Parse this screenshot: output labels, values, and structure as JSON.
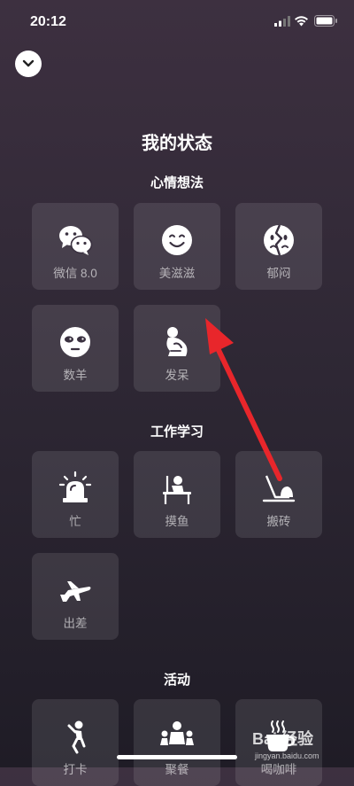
{
  "status_bar": {
    "time": "20:12"
  },
  "page_title": "我的状态",
  "sections": [
    {
      "title": "心情想法",
      "items": [
        {
          "label": "微信 8.0",
          "icon": "wechat-icon"
        },
        {
          "label": "美滋滋",
          "icon": "smile-face-icon"
        },
        {
          "label": "郁闷",
          "icon": "broken-face-icon"
        },
        {
          "label": "数羊",
          "icon": "sleep-mask-face-icon"
        },
        {
          "label": "发呆",
          "icon": "daze-figure-icon"
        }
      ]
    },
    {
      "title": "工作学习",
      "items": [
        {
          "label": "忙",
          "icon": "alarm-siren-icon"
        },
        {
          "label": "摸鱼",
          "icon": "person-at-desk-icon"
        },
        {
          "label": "搬砖",
          "icon": "laptop-brick-icon"
        },
        {
          "label": "出差",
          "icon": "airplane-icon"
        }
      ]
    },
    {
      "title": "活动",
      "items": [
        {
          "label": "打卡",
          "icon": "walking-person-icon"
        },
        {
          "label": "聚餐",
          "icon": "group-people-icon"
        },
        {
          "label": "喝咖啡",
          "icon": "coffee-cup-icon"
        }
      ]
    }
  ],
  "watermark": {
    "logo_text": "Bai 经验",
    "url": "jingyan.baidu.com"
  },
  "colors": {
    "arrow": "#e8262b",
    "tile_bg": "rgba(255,255,255,0.10)",
    "label": "rgba(255,255,255,0.6)"
  }
}
